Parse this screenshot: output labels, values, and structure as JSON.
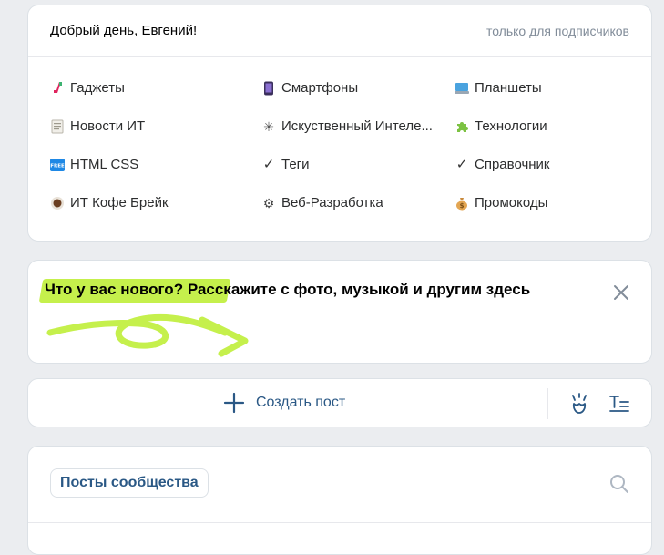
{
  "menu": {
    "greeting": "Добрый день, Евгений!",
    "subscribers_only": "только для подписчиков",
    "items": [
      {
        "label": "Гаджеты",
        "icon": "gadget-icon"
      },
      {
        "label": "Смартфоны",
        "icon": "smartphone-icon"
      },
      {
        "label": "Планшеты",
        "icon": "tablet-icon"
      },
      {
        "label": "Новости ИТ",
        "icon": "news-icon"
      },
      {
        "label": "Искуственный Интеле...",
        "icon": "sparkle-icon"
      },
      {
        "label": "Технологии",
        "icon": "puzzle-icon"
      },
      {
        "label": "HTML CSS",
        "icon": "free-badge-icon"
      },
      {
        "label": "Теги",
        "icon": "check-icon"
      },
      {
        "label": "Справочник",
        "icon": "check-icon"
      },
      {
        "label": "ИТ Кофе Брейк",
        "icon": "coffee-icon"
      },
      {
        "label": "Веб-Разработка",
        "icon": "gear-icon"
      },
      {
        "label": "Промокоды",
        "icon": "money-bag-icon"
      }
    ]
  },
  "whats_new": {
    "question": "Что у вас нового?",
    "prompt": "Расскажите с фото, музыкой и другим здесь"
  },
  "create": {
    "label": "Создать пост"
  },
  "posts": {
    "tab_label": "Посты сообщества"
  },
  "colors": {
    "accent": "#2a5885",
    "highlight": "#c5f04c",
    "background": "#ebedf0"
  }
}
